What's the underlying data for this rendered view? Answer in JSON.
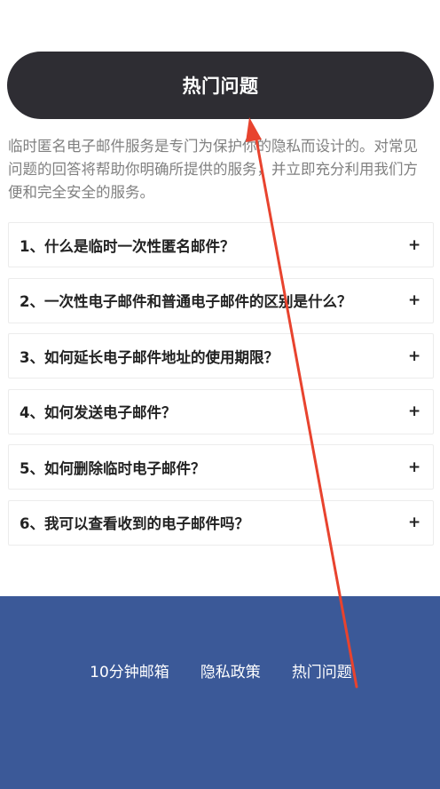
{
  "hero": {
    "title": "热门问题"
  },
  "intro": {
    "text": "临时匿名电子邮件服务是专门为保护你的隐私而设计的。对常见问题的回答将帮助你明确所提供的服务，并立即充分利用我们方便和完全安全的服务。"
  },
  "faq": {
    "items": [
      {
        "question": "1、什么是临时一次性匿名邮件？",
        "toggle": "+"
      },
      {
        "question": "2、一次性电子邮件和普通电子邮件的区别是什么？",
        "toggle": "+"
      },
      {
        "question": "3、如何延长电子邮件地址的使用期限？",
        "toggle": "+"
      },
      {
        "question": "4、如何发送电子邮件？",
        "toggle": "+"
      },
      {
        "question": "5、如何删除临时电子邮件？",
        "toggle": "+"
      },
      {
        "question": "6、我可以查看收到的电子邮件吗？",
        "toggle": "+"
      }
    ]
  },
  "footer": {
    "links": [
      {
        "label": "10分钟邮箱"
      },
      {
        "label": "隐私政策"
      },
      {
        "label": "热门问题"
      }
    ]
  },
  "colors": {
    "pill": "#2e2d33",
    "footer": "#3b5998",
    "arrow": "#e8432e"
  }
}
